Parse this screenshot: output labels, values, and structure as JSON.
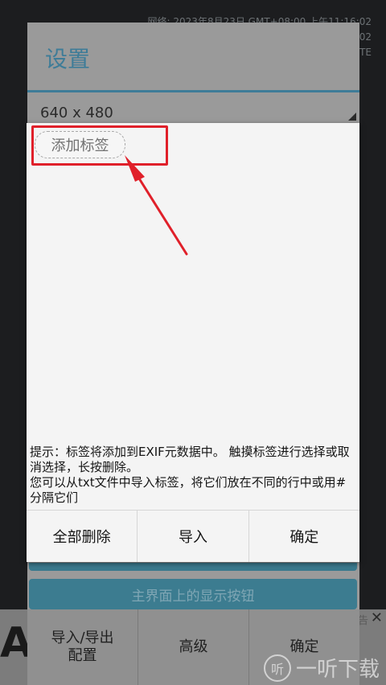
{
  "status": {
    "lines": [
      "网络: 2023年8月23日 GMT+08:00 上午11:16:02",
      "",
      ""
    ],
    "line2": "02",
    "line3": "TE"
  },
  "settings": {
    "title": "设置",
    "resolution": "640 x 480",
    "display_button_label": "主界面上的显示按钮"
  },
  "bottom_bar": {
    "import_export": "导入/导出\n配置",
    "advanced": "高级",
    "confirm": "确定"
  },
  "ad": {
    "left_glyph": "A",
    "tag": "告",
    "close": "✕"
  },
  "watermark": {
    "icon": "听",
    "text": "一听下载"
  },
  "dialog": {
    "tag_chip": "添加标签",
    "hint_line1": "提示：标签将添加到EXIF元数据中。 触摸标签进行选择或取消选择，长按删除。",
    "hint_line2": "您可以从txt文件中导入标签，将它们放在不同的行中或用#分隔它们",
    "buttons": {
      "delete_all": "全部删除",
      "import": "导入",
      "confirm": "确定"
    }
  },
  "colors": {
    "accent": "#3e7c98",
    "annotation": "#e0202a"
  }
}
